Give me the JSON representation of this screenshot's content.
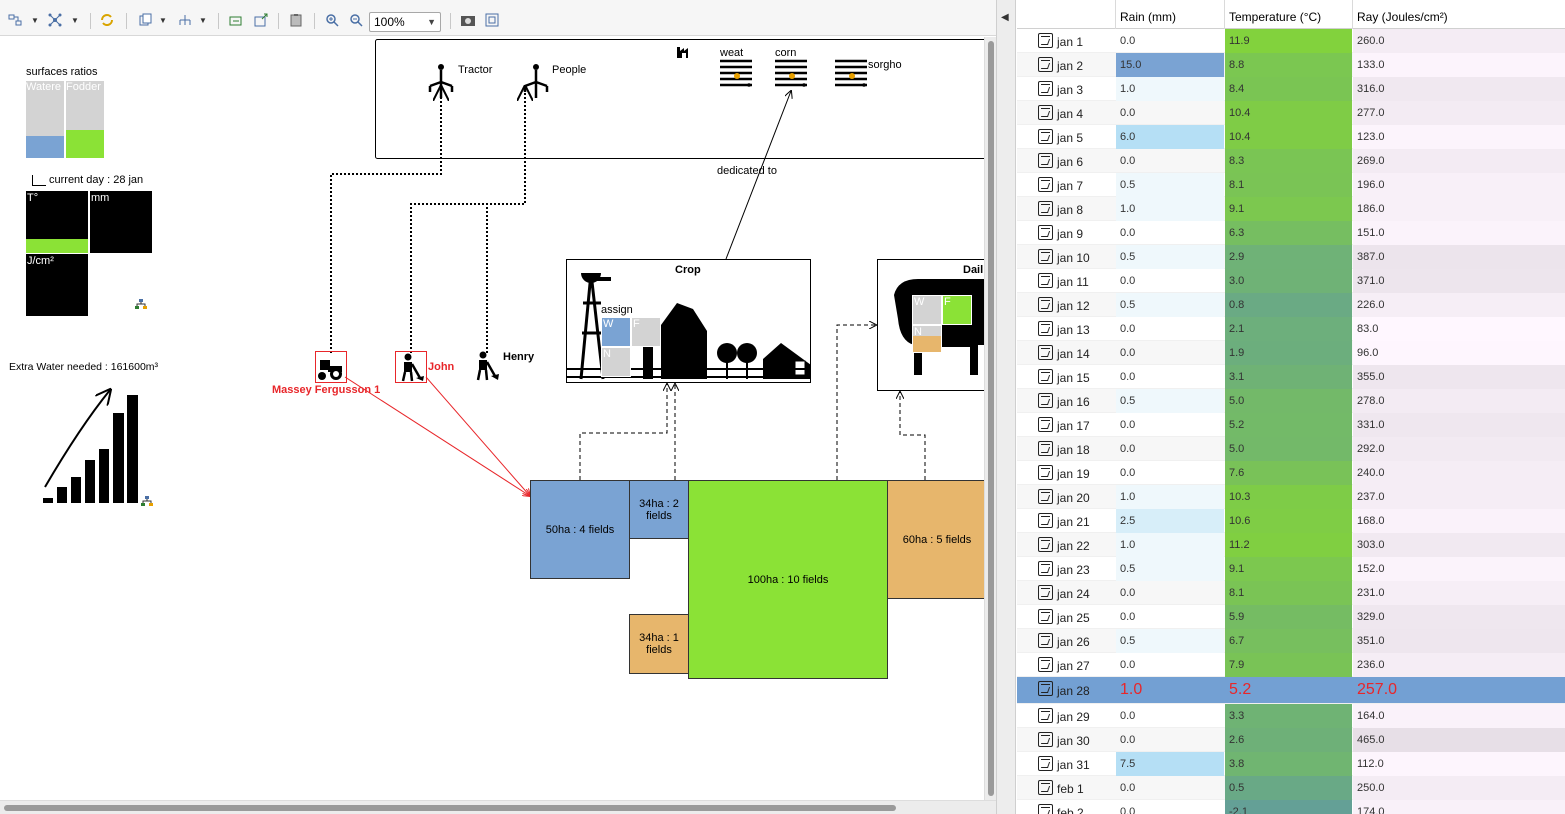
{
  "toolbar": {
    "zoom": "100%",
    "buttons": [
      "layout-icon",
      "graph-icon",
      "refresh-icon",
      "copy-icon",
      "hierarchy-icon",
      "export-icon",
      "import-icon",
      "clipboard-icon",
      "zoom-in-icon",
      "zoom-out-icon",
      "camera-icon",
      "fit-icon"
    ]
  },
  "diagram": {
    "surfaces_title": "surfaces ratios",
    "surf_water": "Watere",
    "surf_fodder": "Fodder",
    "current_day": "current day : 28  jan",
    "temp_label": "T°",
    "mm_label": "mm",
    "ray_label": "J/cm²",
    "extra_water": "Extra Water needed : 161600m³",
    "resources": {
      "tractor": "Tractor",
      "people": "People"
    },
    "crops_top": {
      "weat": "weat",
      "corn": "corn",
      "sorgho": "sorgho"
    },
    "dedicated_to": "dedicated to",
    "crop_title": "Crop",
    "assign_label": "assign",
    "w": "W",
    "f": "F",
    "n": "N",
    "dairy_title": "Dail",
    "agents": {
      "tractor": "Massey Fergusson 1",
      "john": "John",
      "henry": "Henry"
    },
    "fields": {
      "f50": "50ha : 4 fields",
      "f34a": "34ha : 2 fields",
      "f34b": "34ha : 1 fields",
      "f100": "100ha : 10 fields",
      "f60": "60ha : 5 fields"
    },
    "colors": {
      "water": "#7aa3d3",
      "fodder": "#8be236",
      "orange": "#e7b66c",
      "red": "#e8262a",
      "gray": "#d3d3d3"
    }
  },
  "table": {
    "headers": {
      "day": "",
      "rain": "Rain (mm)",
      "temp": "Temperature (°C)",
      "ray": "Ray (Joules/cm²)"
    },
    "rows": [
      {
        "day": "jan 1",
        "rain": "0.0",
        "temp": "11.9",
        "ray": "260.0"
      },
      {
        "day": "jan 2",
        "rain": "15.0",
        "temp": "8.8",
        "ray": "133.0"
      },
      {
        "day": "jan 3",
        "rain": "1.0",
        "temp": "8.4",
        "ray": "316.0"
      },
      {
        "day": "jan 4",
        "rain": "0.0",
        "temp": "10.4",
        "ray": "277.0"
      },
      {
        "day": "jan 5",
        "rain": "6.0",
        "temp": "10.4",
        "ray": "123.0"
      },
      {
        "day": "jan 6",
        "rain": "0.0",
        "temp": "8.3",
        "ray": "269.0"
      },
      {
        "day": "jan 7",
        "rain": "0.5",
        "temp": "8.1",
        "ray": "196.0"
      },
      {
        "day": "jan 8",
        "rain": "1.0",
        "temp": "9.1",
        "ray": "186.0"
      },
      {
        "day": "jan 9",
        "rain": "0.0",
        "temp": "6.3",
        "ray": "151.0"
      },
      {
        "day": "jan 10",
        "rain": "0.5",
        "temp": "2.9",
        "ray": "387.0"
      },
      {
        "day": "jan 11",
        "rain": "0.0",
        "temp": "3.0",
        "ray": "371.0"
      },
      {
        "day": "jan 12",
        "rain": "0.5",
        "temp": "0.8",
        "ray": "226.0"
      },
      {
        "day": "jan 13",
        "rain": "0.0",
        "temp": "2.1",
        "ray": "83.0"
      },
      {
        "day": "jan 14",
        "rain": "0.0",
        "temp": "1.9",
        "ray": "96.0"
      },
      {
        "day": "jan 15",
        "rain": "0.0",
        "temp": "3.1",
        "ray": "355.0"
      },
      {
        "day": "jan 16",
        "rain": "0.5",
        "temp": "5.0",
        "ray": "278.0"
      },
      {
        "day": "jan 17",
        "rain": "0.0",
        "temp": "5.2",
        "ray": "331.0"
      },
      {
        "day": "jan 18",
        "rain": "0.0",
        "temp": "5.0",
        "ray": "292.0"
      },
      {
        "day": "jan 19",
        "rain": "0.0",
        "temp": "7.6",
        "ray": "240.0"
      },
      {
        "day": "jan 20",
        "rain": "1.0",
        "temp": "10.3",
        "ray": "237.0"
      },
      {
        "day": "jan 21",
        "rain": "2.5",
        "temp": "10.6",
        "ray": "168.0"
      },
      {
        "day": "jan 22",
        "rain": "1.0",
        "temp": "11.2",
        "ray": "303.0"
      },
      {
        "day": "jan 23",
        "rain": "0.5",
        "temp": "9.1",
        "ray": "152.0"
      },
      {
        "day": "jan 24",
        "rain": "0.0",
        "temp": "8.1",
        "ray": "231.0"
      },
      {
        "day": "jan 25",
        "rain": "0.0",
        "temp": "5.9",
        "ray": "329.0"
      },
      {
        "day": "jan 26",
        "rain": "0.5",
        "temp": "6.7",
        "ray": "351.0"
      },
      {
        "day": "jan 27",
        "rain": "0.0",
        "temp": "7.9",
        "ray": "236.0"
      },
      {
        "day": "jan 28",
        "rain": "1.0",
        "temp": "5.2",
        "ray": "257.0",
        "selected": true
      },
      {
        "day": "jan 29",
        "rain": "0.0",
        "temp": "3.3",
        "ray": "164.0"
      },
      {
        "day": "jan 30",
        "rain": "0.0",
        "temp": "2.6",
        "ray": "465.0"
      },
      {
        "day": "jan 31",
        "rain": "7.5",
        "temp": "3.8",
        "ray": "112.0"
      },
      {
        "day": "feb 1",
        "rain": "0.0",
        "temp": "0.5",
        "ray": "250.0"
      },
      {
        "day": "feb 2",
        "rain": "0.0",
        "temp": "-2.1",
        "ray": "174.0"
      }
    ]
  }
}
